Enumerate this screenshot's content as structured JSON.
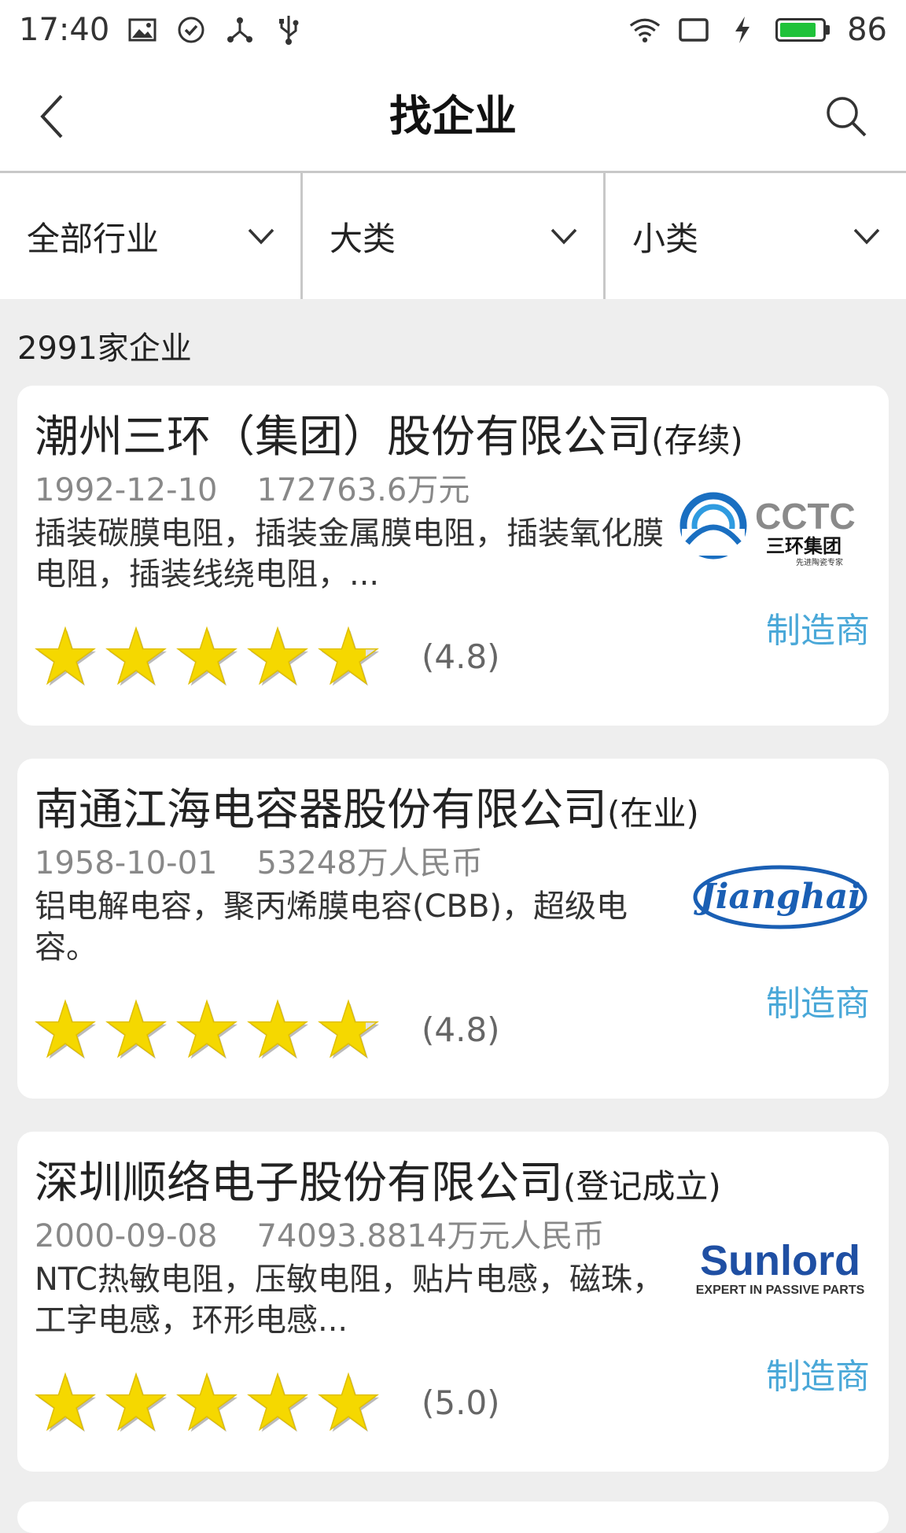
{
  "status_bar": {
    "time": "17:40",
    "battery_level": "86",
    "battery_fraction": 0.86,
    "left_icons": [
      "image-icon",
      "check-circle-icon",
      "share-nodes-icon",
      "usb-icon"
    ],
    "right_icons": [
      "wifi-icon",
      "cast-icon",
      "charging-bolt-icon",
      "battery-icon"
    ]
  },
  "app_bar": {
    "title": "找企业",
    "back_icon": "chevron-left-icon",
    "search_icon": "search-icon"
  },
  "filters": [
    {
      "label": "全部行业"
    },
    {
      "label": "大类"
    },
    {
      "label": "小类"
    }
  ],
  "result_count": "2991家企业",
  "companies": [
    {
      "name": "潮州三环（集团）股份有限公司",
      "status": "(存续)",
      "founded": "1992-12-10",
      "capital": "172763.6万元",
      "description": "插装碳膜电阻，插装金属膜电阻，插装氧化膜电阻，插装线绕电阻，...",
      "role": "制造商",
      "rating": "(4.8)",
      "stars": 4.8,
      "logo": {
        "line1": "CCTC",
        "line2": "三环集团",
        "line3": "先进陶瓷专家"
      }
    },
    {
      "name": "南通江海电容器股份有限公司",
      "status": "(在业)",
      "founded": "1958-10-01",
      "capital": "53248万人民币",
      "description": "铝电解电容，聚丙烯膜电容(CBB)，超级电容。",
      "role": "制造商",
      "rating": "(4.8)",
      "stars": 4.8,
      "logo": {
        "text": "Jianghai"
      }
    },
    {
      "name": "深圳顺络电子股份有限公司",
      "status": "(登记成立)",
      "founded": "2000-09-08",
      "capital": "74093.8814万元人民币",
      "description": "NTC热敏电阻，压敏电阻，贴片电感，磁珠，工字电感，环形电感...",
      "role": "制造商",
      "rating": "(5.0)",
      "stars": 5.0,
      "logo": {
        "line1": "Sunlord",
        "line2": "EXPERT IN PASSIVE PARTS"
      }
    }
  ],
  "colors": {
    "accent": "#4aa8d8",
    "star": "#f5d800",
    "battery": "#1fc23a",
    "background": "#eeeeee"
  }
}
